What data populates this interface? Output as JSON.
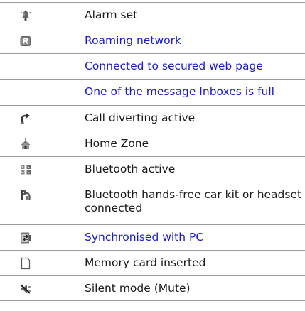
{
  "rows": [
    {
      "icon": "alarm-bell-icon",
      "label": "Alarm set",
      "link": false
    },
    {
      "icon": "roaming-r-icon",
      "label": "Roaming network",
      "link": true
    },
    {
      "icon": "",
      "label": "Connected to secured web page",
      "link": true
    },
    {
      "icon": "",
      "label": "One of the message Inboxes is full",
      "link": true
    },
    {
      "icon": "call-divert-arrow-icon",
      "label": "Call diverting active",
      "link": false
    },
    {
      "icon": "home-zone-house-icon",
      "label": "Home Zone",
      "link": false
    },
    {
      "icon": "bluetooth-icon",
      "label": "Bluetooth active",
      "link": false
    },
    {
      "icon": "car-kit-headset-icon",
      "label": "Bluetooth hands-free car kit or headset connected",
      "link": false
    },
    {
      "icon": "pc-sync-icon",
      "label": "Synchronised with PC",
      "link": true
    },
    {
      "icon": "memory-card-icon",
      "label": "Memory card inserted",
      "link": false
    },
    {
      "icon": "mute-speaker-icon",
      "label": "Silent mode (Mute)",
      "link": false
    }
  ],
  "colors": {
    "text": "#1a1a1a",
    "link": "#1a1acc",
    "rule": "#9a9a9a",
    "icon": "#555555"
  }
}
